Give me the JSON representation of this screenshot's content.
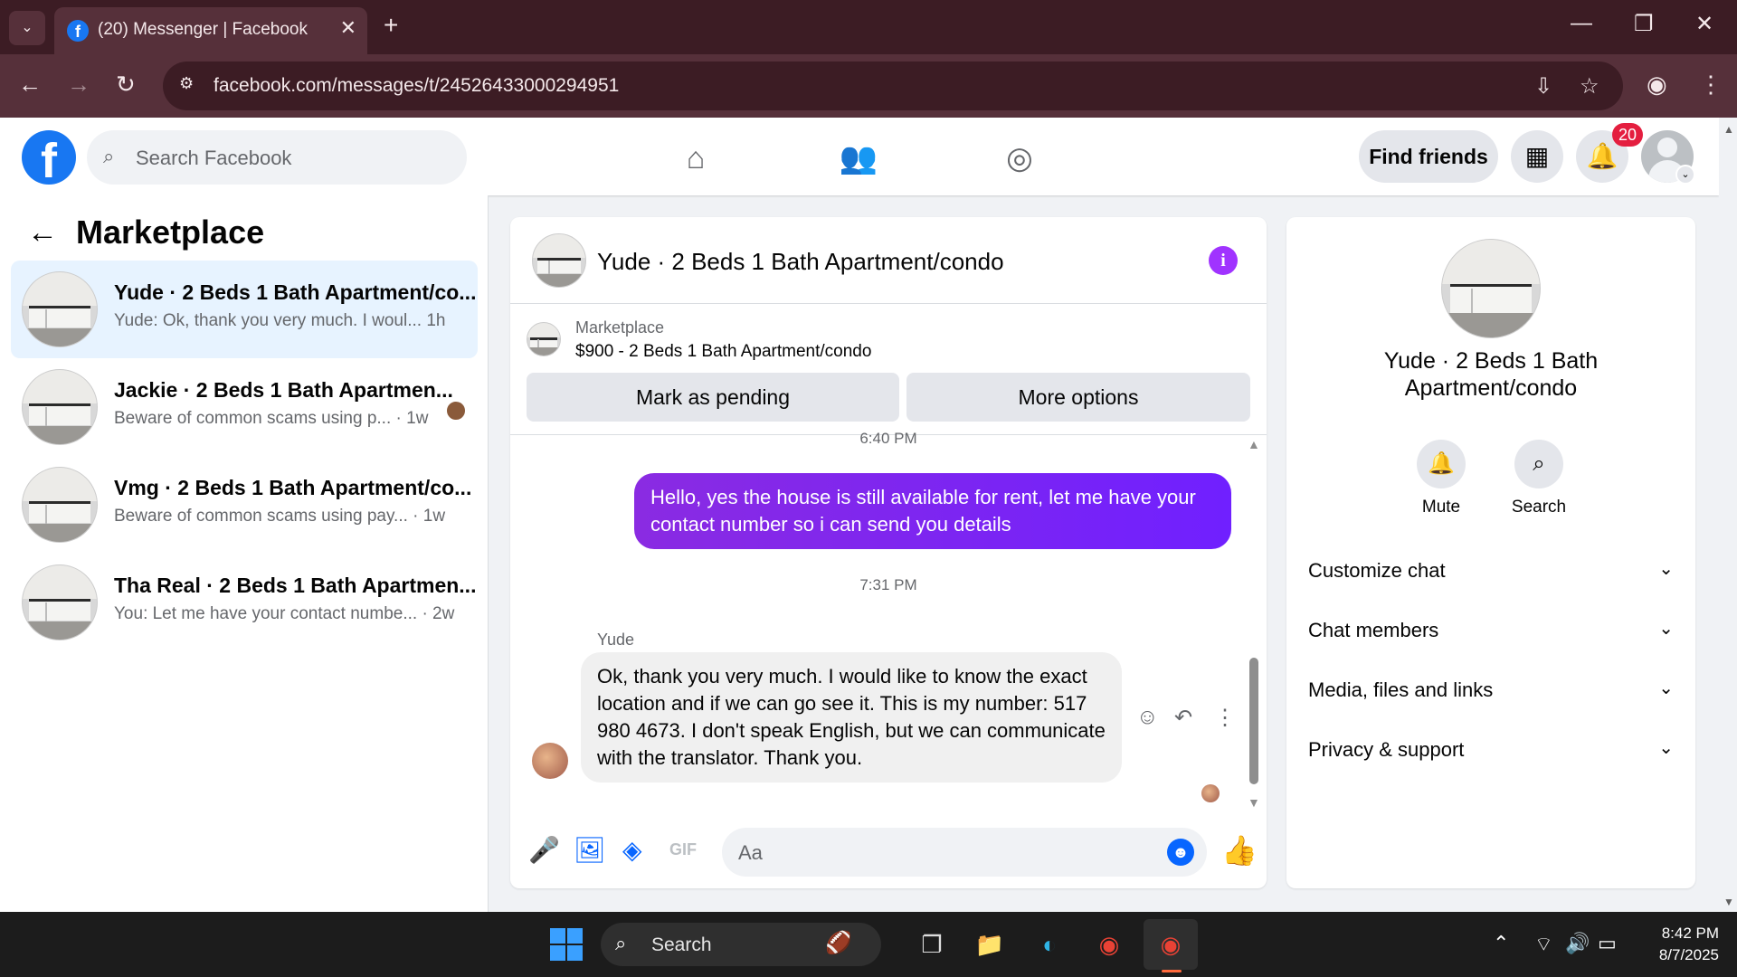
{
  "browser": {
    "tab_title": "(20) Messenger | Facebook",
    "url": "facebook.com/messages/t/24526433000294951"
  },
  "header": {
    "search_placeholder": "Search Facebook",
    "find_friends": "Find friends",
    "notification_count": "20"
  },
  "sidebar": {
    "title": "Marketplace",
    "conversations": [
      {
        "name": "Yude · 2 Beds 1 Bath Apartment/co...",
        "preview": "Yude: Ok, thank you very much. I woul... 1h",
        "active": true
      },
      {
        "name": "Jackie · 2 Beds 1 Bath Apartmen...",
        "preview": "Beware of common scams using p... · 1w",
        "active": false
      },
      {
        "name": "Vmg · 2 Beds 1 Bath Apartment/co...",
        "preview": "Beware of common scams using pay... · 1w",
        "active": false
      },
      {
        "name": "Tha Real · 2 Beds 1 Bath Apartmen...",
        "preview": "You: Let me have your contact numbe... · 2w",
        "active": false
      }
    ]
  },
  "chat": {
    "title": "Yude · 2 Beds 1 Bath Apartment/condo",
    "listing_label": "Marketplace",
    "listing_price": "$900 - 2 Beds 1 Bath Apartment/condo",
    "mark_pending": "Mark as pending",
    "more_options": "More options",
    "time1": "6:40 PM",
    "outgoing_message": "Hello, yes the house is still available for rent, let me have your contact number so i can send you details",
    "time2": "7:31 PM",
    "sender": "Yude",
    "incoming_message": "Ok, thank you very much. I would like to know the exact location and if we can go see it. This is my number: 517 980 4673. I don't speak English, but we can communicate with the translator. Thank you.",
    "composer_placeholder": "Aa"
  },
  "info_panel": {
    "title": "Yude · 2 Beds 1 Bath Apartment/condo",
    "mute": "Mute",
    "search": "Search",
    "sections": [
      "Customize chat",
      "Chat members",
      "Media, files and links",
      "Privacy & support"
    ]
  },
  "taskbar": {
    "search_label": "Search",
    "time": "8:42 PM",
    "date": "8/7/2025"
  },
  "colors": {
    "accent": "#0866ff",
    "outgoing_bubble": "#7a24f5",
    "info_icon": "#a033ff",
    "badge": "#e41e3f",
    "chrome_dark": "#3c1c24",
    "chrome_toolbar": "#56303a"
  }
}
